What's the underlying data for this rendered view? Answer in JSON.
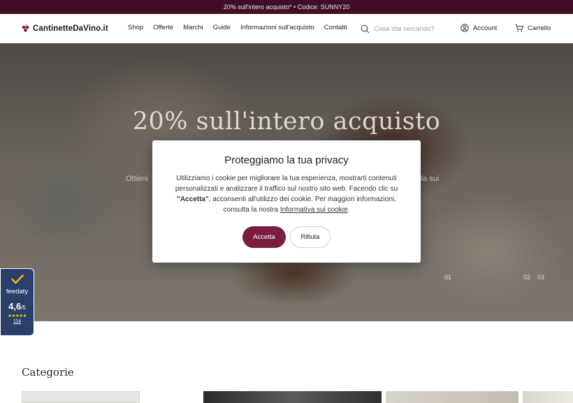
{
  "promo": {
    "text": "20% sull'intero acquisto* • Codice: SUNNY20"
  },
  "header": {
    "logo": "CantinetteDaVino.it",
    "nav": [
      "Shop",
      "Offerte",
      "Marchi",
      "Guide",
      "Informazioni sull'acquisto",
      "Contatti"
    ],
    "search": {
      "placeholder": "Cosa stai cercando?"
    },
    "account_label": "Account",
    "cart_label": "Carrello"
  },
  "hero": {
    "title": "20% sull'intero acquisto",
    "subtitle_left": "Ottieni",
    "subtitle_right": "alida sui",
    "slide_current": "01",
    "slide_other": [
      "02",
      "03"
    ]
  },
  "cookie_modal": {
    "title": "Proteggiamo la tua privacy",
    "body_1": "Utilizziamo i cookie per migliorare la tua esperienza, mostrarti contenuti personalizzati e analizzare il traffico sul nostro sito web. Facendo clic su ",
    "body_strong": "\"Accetta\"",
    "body_2": ", acconsenti all'utilizzo dei cookie. Per maggiori informazioni, consulta la nostra ",
    "body_link": "Informativa sui cookie",
    "body_end": ".",
    "accept_label": "Accetta",
    "reject_label": "Rifiuta"
  },
  "feedaty": {
    "name": "feedaty",
    "rating": "4,6",
    "rating_max": "/5",
    "stars": "★★★★★",
    "count": "114"
  },
  "categories": {
    "title": "Categorie"
  },
  "colors": {
    "brand": "#7b1d42",
    "promo_bg": "#3f0d27",
    "feedaty_bg": "#2b3f6b"
  }
}
